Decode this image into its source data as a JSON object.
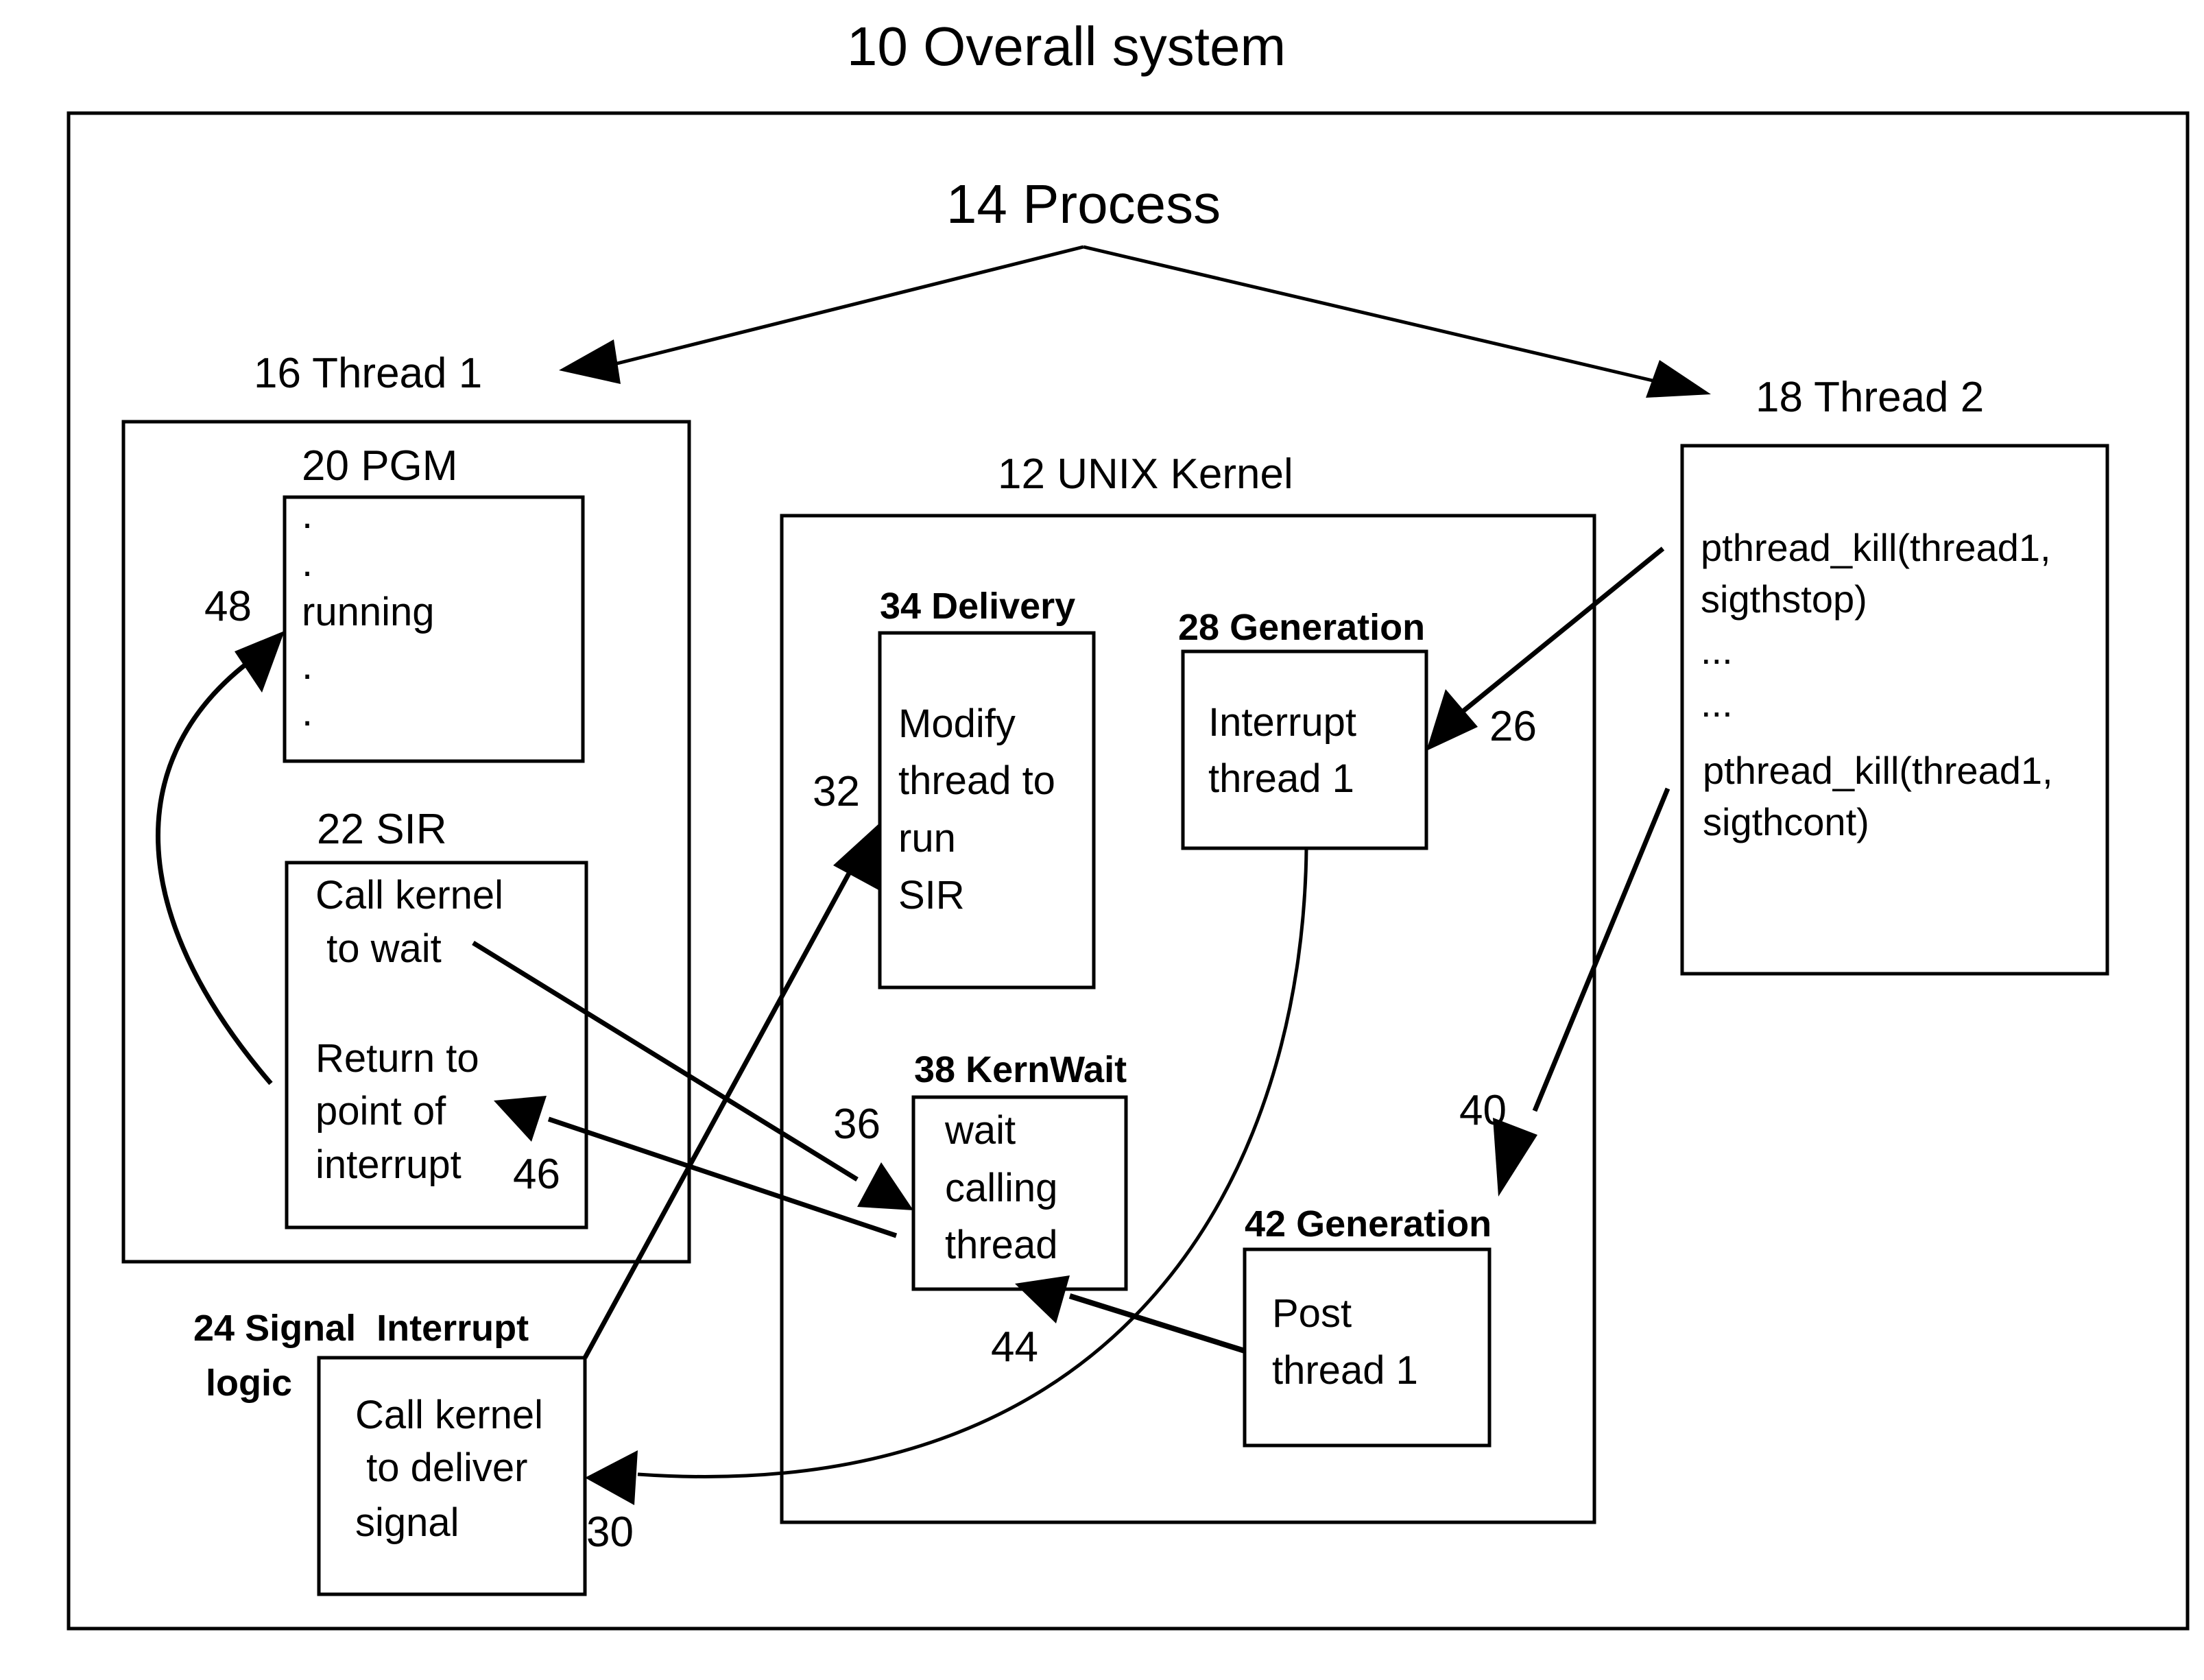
{
  "title": "10 Overall system",
  "process": {
    "label": "14 Process"
  },
  "threads": {
    "thread1": {
      "label": "16 Thread 1"
    },
    "thread2": {
      "label": "18 Thread 2",
      "lines": [
        "pthread_kill(thread1,",
        "sigthstop)",
        "...",
        "...",
        "pthread_kill(thread1,",
        "sigthcont)"
      ]
    }
  },
  "pgm": {
    "label": "20 PGM",
    "lines": [
      ".",
      ".",
      "running",
      ".",
      "."
    ]
  },
  "sir": {
    "label": "22 SIR",
    "lines": [
      "Call kernel",
      " to wait",
      "Return to",
      "point of",
      "interrupt"
    ]
  },
  "signal_interrupt": {
    "label_line1": "24 Signal  Interrupt",
    "label_line2": "logic",
    "lines": [
      "Call kernel",
      " to deliver",
      "signal"
    ]
  },
  "kernel": {
    "label": "12 UNIX Kernel"
  },
  "delivery": {
    "label": "34 Delivery",
    "lines": [
      "Modify",
      "thread to",
      "run",
      "SIR"
    ]
  },
  "generation28": {
    "label": "28 Generation",
    "lines": [
      "Interrupt",
      "thread 1"
    ]
  },
  "kernwait": {
    "label": "38 KernWait",
    "lines": [
      "wait",
      "calling",
      "thread"
    ]
  },
  "generation42": {
    "label": "42 Generation",
    "lines": [
      "Post",
      "thread 1"
    ]
  },
  "ref_numbers": {
    "n26": "26",
    "n30": "30",
    "n32": "32",
    "n36": "36",
    "n40": "40",
    "n44": "44",
    "n46": "46",
    "n48": "48"
  }
}
